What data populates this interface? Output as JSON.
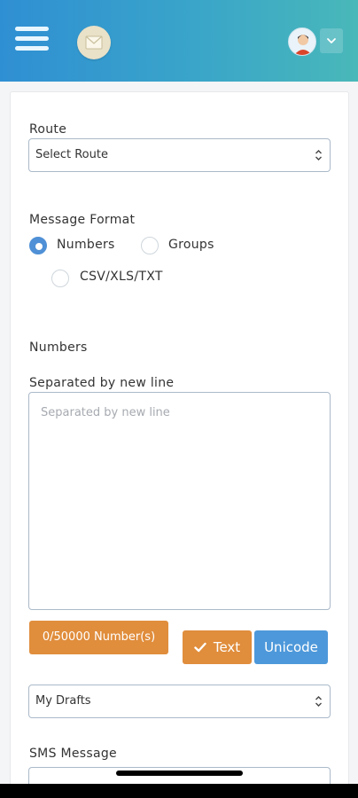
{
  "header": {
    "menu_icon": "hamburger-menu-icon",
    "logo_icon": "envelope-icon",
    "avatar_icon": "user-avatar-icon",
    "dropdown_icon": "chevron-down-icon",
    "gradient_colors": [
      "#2f8fd3",
      "#49b8b9"
    ]
  },
  "form": {
    "route": {
      "label": "Route",
      "selected": "Select Route"
    },
    "message_format": {
      "label": "Message Format",
      "options": [
        {
          "label": "Numbers",
          "checked": true
        },
        {
          "label": "Groups",
          "checked": false
        },
        {
          "label": "CSV/XLS/TXT",
          "checked": false
        }
      ]
    },
    "numbers": {
      "section_label": "Numbers",
      "field_label": "Separated by new line",
      "placeholder": "Separated by new line",
      "value": ""
    },
    "counter": {
      "text": "0/50000 Number(s)"
    },
    "encoding": {
      "text_button": "Text",
      "unicode_button": "Unicode",
      "selected": "Text"
    },
    "drafts": {
      "selected": "My Drafts"
    },
    "sms_message": {
      "label": "SMS Message"
    }
  },
  "colors": {
    "accent_orange": "#e08d3c",
    "accent_blue": "#4d98da",
    "radio_selected": "#4f90d6"
  }
}
